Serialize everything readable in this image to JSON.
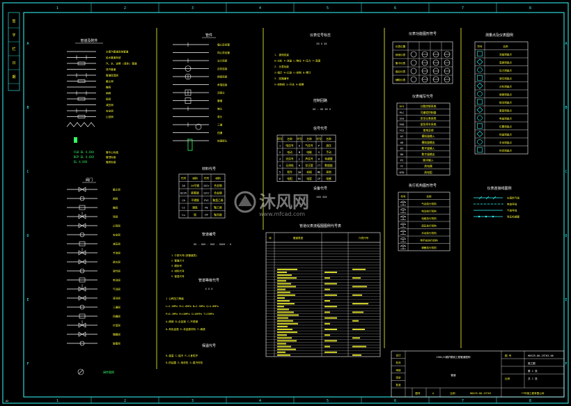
{
  "frame": {
    "zone_labels_top": [
      "1",
      "2",
      "3",
      "4",
      "5",
      "6",
      "7",
      "8"
    ],
    "zone_labels_side": [
      "A",
      "B",
      "C",
      "D",
      "E",
      "F"
    ],
    "sheet_size": "A2",
    "side_stamp_cells": [
      "签",
      "字",
      "栏",
      "日",
      "期"
    ]
  },
  "watermark": {
    "brand": "沐风网",
    "url": "www.mfcad.com"
  },
  "column1": {
    "section_pipe_symbols": "管道及附件",
    "pipe_symbol_labels": [
      "主蒸汽管道系统管道",
      "给水管道系统",
      "汽、水、油等 (液体) 管道",
      "排汽管道",
      "管道保温层",
      "截止阀",
      "蝶阀",
      "闸阀",
      "角阀",
      "减压阀",
      "安全阀",
      "止回阀"
    ],
    "elevation_labels": [
      "FGO EL X.XXX",
      "BCP EL X.XXX",
      "EL X.XXX"
    ],
    "elevation_desc": [
      "管中心标高",
      "管顶标高",
      "管底标高"
    ],
    "section_valves": "阀门",
    "valve_labels": [
      "截止阀",
      "闸阀",
      "蝶阀",
      "球阀",
      "止回阀",
      "安全阀",
      "减压阀",
      "节流阀",
      "疏水阀",
      "调节阀",
      "电动阀",
      "气动阀",
      "液动阀",
      "三通阀",
      "四通阀",
      "针型阀",
      "隔膜阀",
      "旋塞阀"
    ],
    "footer_label": "阀件图例"
  },
  "column2": {
    "section_fittings": "管件",
    "fitting_labels": [
      "偏心异径管",
      "同心异径管",
      "法兰连接",
      "丝扣连接",
      "焊接连接",
      "承插连接",
      "活接头",
      "管帽",
      "堵头",
      "弯头",
      "三通",
      "四通",
      "快速接头"
    ],
    "section_material": "材料代号",
    "material_table": [
      [
        "代号",
        "材料",
        "代号",
        "材料"
      ],
      [
        "20",
        "20号钢",
        "15Cr",
        "合金钢"
      ],
      [
        "Q235",
        "碳素钢",
        "12Cr",
        "合金钢"
      ],
      [
        "CA",
        "不锈钢",
        "PVC",
        "聚氯乙烯"
      ],
      [
        "CI",
        "铸铁",
        "PE",
        "聚乙烯"
      ],
      [
        "Cu",
        "铜",
        "PP",
        "聚丙烯"
      ]
    ],
    "section_pipe_code": "管道编号",
    "pipe_code_format": "XX - XXX - XXX - XXXX - X",
    "pipe_code_parts": [
      "1  介质代号(按管道表)",
      "2  管道尺寸",
      "3  顺序号",
      "4  材料代号",
      "5  保温代号"
    ],
    "section_pressure": "管道等级代号",
    "pressure_format": "X  X  X",
    "pressure_lines": [
      "1  公称压力等级",
      "L<1.6MPa  M=1.6MPa  N=2.5MPa  Q=4.0MPa",
      "P=6.4MPa  R=10MPa  S=16MPa  T=25MPa",
      "A—碳钢    B—合金钢    C—不锈钢",
      "D—有色金属  E—非金属材料  F—铸铁"
    ],
    "section_insulation": "保温代号",
    "insulation_lines": [
      "H—保温   C—保冷   P—人身防护",
      "D—防结露  E—电伴热  S—蒸汽伴热"
    ]
  },
  "column3": {
    "section_instrument": "仪表位号标志",
    "instrument_format": "XX  X  XX",
    "instrument_lines": [
      "1. 被测变量",
      "A—分析  F—流量  L—物位  P—压力  T—温度",
      "2. 仪表功能",
      "I—指示  R—记录  C—控制  Q—累计",
      "3. 回路编号",
      "V—控制阀  S—开关  A—报警"
    ],
    "section_loop": "控制回路",
    "loop_format": "XX - XX  XX  X",
    "section_signal": "信号代号",
    "signal_table": [
      [
        "序号",
        "名称",
        "代号",
        "名称",
        "代号",
        "名称"
      ],
      [
        "1",
        "电信号",
        "E",
        "气信号",
        "P",
        "液压"
      ],
      [
        "2",
        "电动",
        "M",
        "电磁",
        "S",
        "手动"
      ],
      [
        "3",
        "光信号",
        "L",
        "声信号",
        "A",
        "毛细管"
      ],
      [
        "4",
        "无线电",
        "R",
        "导压管",
        "CT",
        "数据链"
      ],
      [
        "5",
        "软件",
        "SW",
        "机械",
        "ME",
        "其他"
      ],
      [
        "6",
        "电阻",
        "RS",
        "电容",
        "CP",
        "电感"
      ]
    ],
    "section_device": "设备代号",
    "device_format": "XXX XXX",
    "section_main_table": "管道仪表流程图图例代号表",
    "main_table_header": [
      "序",
      "管道类型",
      "",
      "介质代号"
    ],
    "main_table_rows": 40,
    "title_block_title": "250t/h锅炉脱硫工程管道图例",
    "title_block_sub": "管道",
    "title_block_number": "HDSCR-00-JST03-00"
  },
  "column4": {
    "section_inst_symbols": "仪表功能图形符号",
    "inst_symbol_table_rows": [
      "仪表位置",
      "就地仪表",
      "集中仪表",
      "盘后仪表",
      "辅助仪表"
    ],
    "section_abbr": "仪表缩写代号",
    "abbr_table": [
      [
        "DCS",
        "分散控制系统"
      ],
      [
        "PLC",
        "可编程控制器"
      ],
      [
        "SIS",
        "安全仪表系统"
      ],
      [
        "ESD",
        "紧急停车系统"
      ],
      [
        "FCS",
        "现场总线"
      ],
      [
        "AI",
        "模拟量输入"
      ],
      [
        "AO",
        "模拟量输出"
      ],
      [
        "DI",
        "数字量输入"
      ],
      [
        "DO",
        "数字量输出"
      ],
      [
        "PI",
        "脉冲输入"
      ],
      [
        "TC",
        "热电偶"
      ],
      [
        "RTD",
        "热电阻"
      ]
    ],
    "section_valve_actuator": "执行机构图形符号",
    "actuator_table": [
      [
        "符号",
        "名称"
      ],
      [
        "A",
        "气动执行机构"
      ],
      [
        "B",
        "电动执行机构"
      ],
      [
        "C",
        "电磁执行机构"
      ],
      [
        "D",
        "液压执行机构"
      ],
      [
        "E",
        "手动执行机构"
      ],
      [
        "F",
        "带手轮执行机构"
      ],
      [
        "G",
        "弹簧执行机构"
      ]
    ]
  },
  "column5": {
    "section_measure": "测量点及仪表图例",
    "measure_table": [
      [
        "符号",
        "名称"
      ],
      [
        "F",
        "流量测量点"
      ],
      [
        "T",
        "温度测量点"
      ],
      [
        "P",
        "压力测量点"
      ],
      [
        "L",
        "液位测量点"
      ],
      [
        "A",
        "分析测量点"
      ],
      [
        "S",
        "速度测量点"
      ],
      [
        "V",
        "振动测量点"
      ],
      [
        "W",
        "重量测量点"
      ],
      [
        "E",
        "电量测量点"
      ],
      [
        "Z",
        "位置测量点"
      ],
      [
        "Q",
        "热量测量点"
      ],
      [
        "H",
        "手动测量点"
      ],
      [
        "K",
        "时间测量点"
      ]
    ],
    "section_lines": "仪表连接线图例",
    "line_labels": [
      "仪表供气线",
      "电信号线",
      "气信号线",
      "导压毛细管"
    ]
  },
  "title_block": {
    "labels": [
      "设计",
      "校对",
      "审核",
      "审定",
      "批准"
    ],
    "right_top": "图 号",
    "drawing_no": "HDSCR-00-JST03-00",
    "stage": "施工图",
    "sheet_lbl": "第 1 张",
    "sheet_total": "共 1 张",
    "scale_lbl": "比例",
    "company": "**环境工程有限公司",
    "bottom_cells": [
      "图号",
      "A",
      "比例",
      "HDSCR-00-JST03"
    ]
  },
  "colors": {
    "frame": "#33ffff",
    "divider": "#ffff33",
    "text_yellow": "#ffff33",
    "text_white": "#ffffff",
    "text_green": "#33ff66",
    "table_line": "#ffffff"
  }
}
